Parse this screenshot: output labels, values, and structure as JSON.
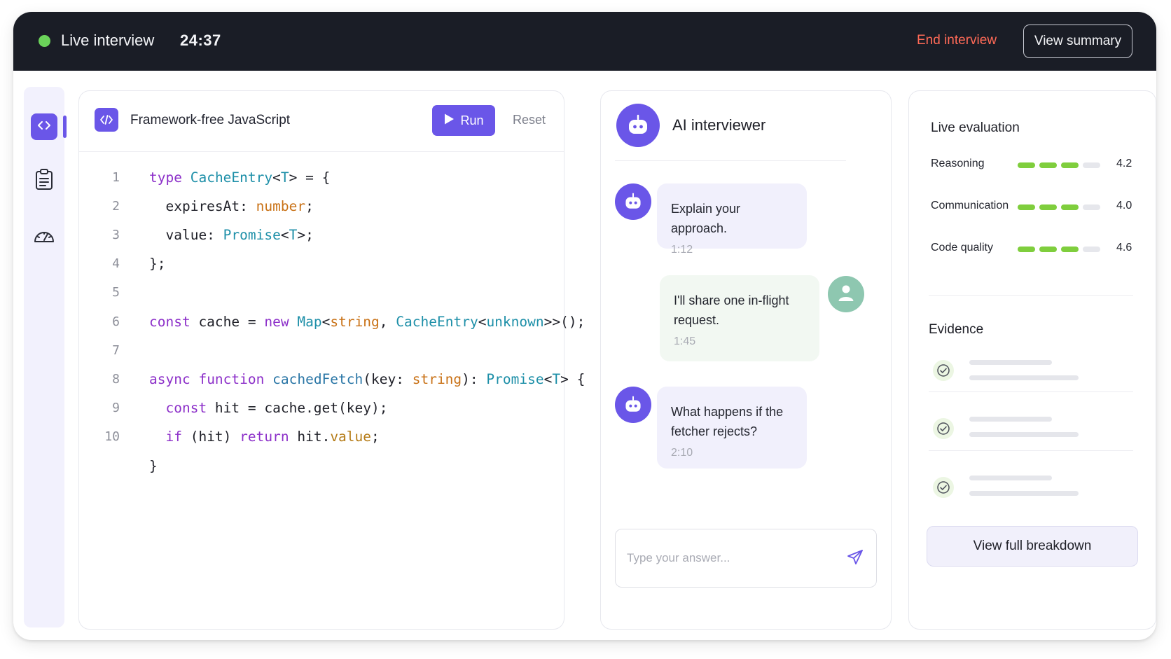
{
  "header": {
    "status_label": "Live interview",
    "timer": "24:37",
    "end_label": "End interview",
    "summary_label": "View summary",
    "status_color": "#6bd35a",
    "end_color": "#ff6a57"
  },
  "sidebar": {
    "items": [
      {
        "icon": "code-icon",
        "active": true
      },
      {
        "icon": "clipboard-icon",
        "active": false
      },
      {
        "icon": "speedometer-icon",
        "active": false
      }
    ]
  },
  "editor": {
    "file_name": "Framework-free JavaScript",
    "run_label": "Run",
    "reset_label": "Reset",
    "line_numbers": [
      "1",
      "2",
      "3",
      "4",
      "5",
      "6",
      "7",
      "8",
      "9",
      "10",
      ""
    ],
    "code_lines": [
      "type CacheEntry<T> = {",
      "  expiresAt: number;",
      "  value: Promise<T>;",
      "};",
      "",
      "const cache = new Map<string, CacheEntry<unknown>>();",
      "",
      "async function cachedFetch(key: string): Promise<T> {",
      "  const hit = cache.get(key);",
      "  if (hit) return hit.value;",
      "}"
    ]
  },
  "chat": {
    "title": "AI interviewer",
    "messages": [
      {
        "sender": "bot",
        "text": "Explain your approach.",
        "time": "1:12"
      },
      {
        "sender": "user",
        "text": "I'll share one in-flight request.",
        "time": "1:45"
      },
      {
        "sender": "bot",
        "text": "What happens if the fetcher rejects?",
        "time": "2:10"
      }
    ],
    "input_placeholder": "Type your answer...",
    "accent": "#6a56e8"
  },
  "evaluation": {
    "title": "Live evaluation",
    "metrics": [
      {
        "label": "Reasoning",
        "value": "4.2",
        "segments_filled": 3,
        "segments_total": 4
      },
      {
        "label": "Communication",
        "value": "4.0",
        "segments_filled": 3,
        "segments_total": 4
      },
      {
        "label": "Code quality",
        "value": "4.6",
        "segments_filled": 3,
        "segments_total": 4
      }
    ],
    "evidence_title": "Evidence",
    "evidence_count": 3,
    "breakdown_label": "View full breakdown",
    "bar_color": "#7fce3d"
  }
}
